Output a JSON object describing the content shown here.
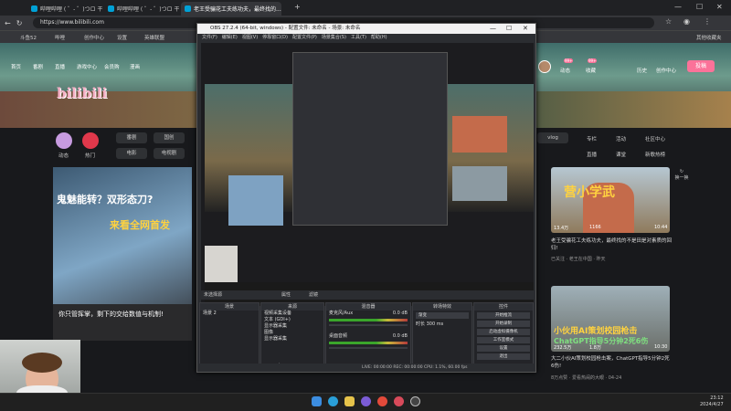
{
  "browser": {
    "tabs": [
      {
        "label": "哔哩哔哩 ( ゜- ゜)つロ 干杯~-bilibili"
      },
      {
        "label": "哔哩哔哩 ( ゜- ゜)つロ 干杯~-bilibili"
      },
      {
        "label": "老王受骗花工夫练功夫，最终找的..."
      }
    ],
    "url": "https://www.bilibili.com",
    "bookmarks": [
      "斗鱼52",
      "哔哩",
      "创作中心",
      "设置",
      "英雄联盟",
      "其他收藏夹"
    ]
  },
  "bili": {
    "nav": [
      "首页",
      "番剧",
      "直播",
      "游戏中心",
      "会员购",
      "漫画"
    ],
    "right_nav": [
      "动态",
      "收藏",
      "历史",
      "创作中心"
    ],
    "upload": "投稿",
    "badges": [
      "99+",
      "99+"
    ],
    "quick": [
      "动态",
      "热门"
    ],
    "categories_row1": [
      "番剧",
      "国创"
    ],
    "categories_row2": [
      "电影",
      "电视剧"
    ],
    "right_links": [
      "专栏",
      "活动",
      "社区中心"
    ],
    "right_links2": [
      "直播",
      "课堂",
      "新歌热榜"
    ],
    "vlog": "vlog",
    "feed_headline_1": "鬼魅能转？双形态刀?",
    "feed_headline_2": "来看全网首发",
    "feed_caption": "你只管挥掌，剩下的交给数值与机制!",
    "cards": [
      {
        "overlay": "营小学武",
        "views": "13.4万",
        "danmaku": "1166",
        "duration": "10:44",
        "title": "老王受骗花工夫练功夫，最终找的不是田是对素质的回归!",
        "author": "已关注 · 老王在中国 · 昨天"
      },
      {
        "overlay": "小伙用AI策划校园枪击",
        "overlay2": "ChatGPT指导5分钟2死6伤",
        "views": "232.5万",
        "danmaku": "1.8万",
        "duration": "10:30",
        "title": "大二小伙AI策划校园枪击案，ChatGPT指导5分钟2死6伤!",
        "author": "8万点赞 · 爱看热闹的大眼 · 04-24"
      }
    ],
    "side_actions": [
      "换一换"
    ]
  },
  "obs": {
    "title": "OBS 27.2.4 (64-bit, windows) - 配置文件: 未命名 - 场景: 未命名",
    "menu": [
      "文件(F)",
      "编辑(E)",
      "视图(V)",
      "停靠窗口(D)",
      "配置文件(P)",
      "场景集合(S)",
      "工具(T)",
      "帮助(H)"
    ],
    "source_bar": "未选择源",
    "source_bar_buttons": [
      "属性",
      "滤镜"
    ],
    "docks": {
      "scenes": {
        "title": "场景",
        "items": [
          "场景 2"
        ]
      },
      "sources": {
        "title": "来源",
        "items": [
          "视频采集设备",
          "文本 (GDI+)",
          "显示器采集",
          "图像",
          "显示器采集"
        ]
      },
      "mixer": {
        "title": "混音器",
        "channels": [
          {
            "name": "麦克风/Aux",
            "db": "0.0 dB"
          },
          {
            "name": "桌面音频",
            "db": "0.0 dB"
          }
        ]
      },
      "transitions": {
        "title": "转场特效",
        "type": "渐变",
        "duration_label": "时长",
        "duration": "300 ms"
      },
      "controls": {
        "title": "控件",
        "buttons": [
          "开始推流",
          "开始录制",
          "启动虚拟摄像机",
          "工作室模式",
          "设置",
          "退出"
        ]
      }
    },
    "status": "LIVE: 00:00:00    REC: 00:00:00    CPU: 1.1%, 60.00 fps"
  },
  "taskbar": {
    "time": "23:12",
    "date": "2024/4/27"
  },
  "colors": {
    "accent": "#fb7299",
    "brand": "#00a1d6"
  }
}
